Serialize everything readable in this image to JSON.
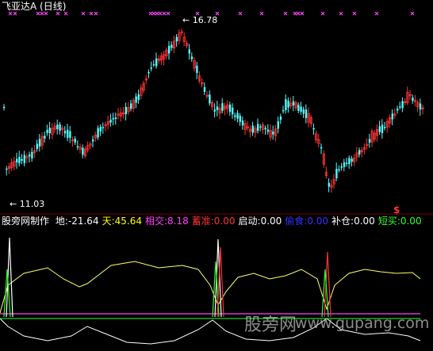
{
  "window": {
    "stock_title": "飞亚达A (日线)",
    "high_label": "16.78",
    "low_label": "11.03",
    "signal_glyph": "$"
  },
  "indicator": {
    "name": "股旁网制作",
    "items": [
      {
        "label": "地:",
        "value": "-21.64",
        "color": "#ffffff"
      },
      {
        "label": "天:",
        "value": "45.64",
        "color": "#ffff00"
      },
      {
        "label": "相交:",
        "value": "8.18",
        "color": "#ff44ff"
      },
      {
        "label": "蓄准:",
        "value": "0.00",
        "color": "#ff3333"
      },
      {
        "label": "启动:",
        "value": "0.00",
        "color": "#ffffff"
      },
      {
        "label": "偷食:",
        "value": "0.00",
        "color": "#3333ff"
      },
      {
        "label": "补仓:",
        "value": "0.00",
        "color": "#ffffff"
      },
      {
        "label": "短买:",
        "value": "0.00",
        "color": "#33ff33"
      }
    ]
  },
  "watermark": {
    "text": "股旁网",
    "url": "www.gupang.com"
  },
  "colors": {
    "up_candle": "#ff3333",
    "down_candle": "#54ffff",
    "marker": "#ff44ff",
    "yellow_line": "#ffff66",
    "white_line": "#ffffff",
    "magenta_line": "#ff44ff",
    "green_line": "#33ff33"
  }
}
